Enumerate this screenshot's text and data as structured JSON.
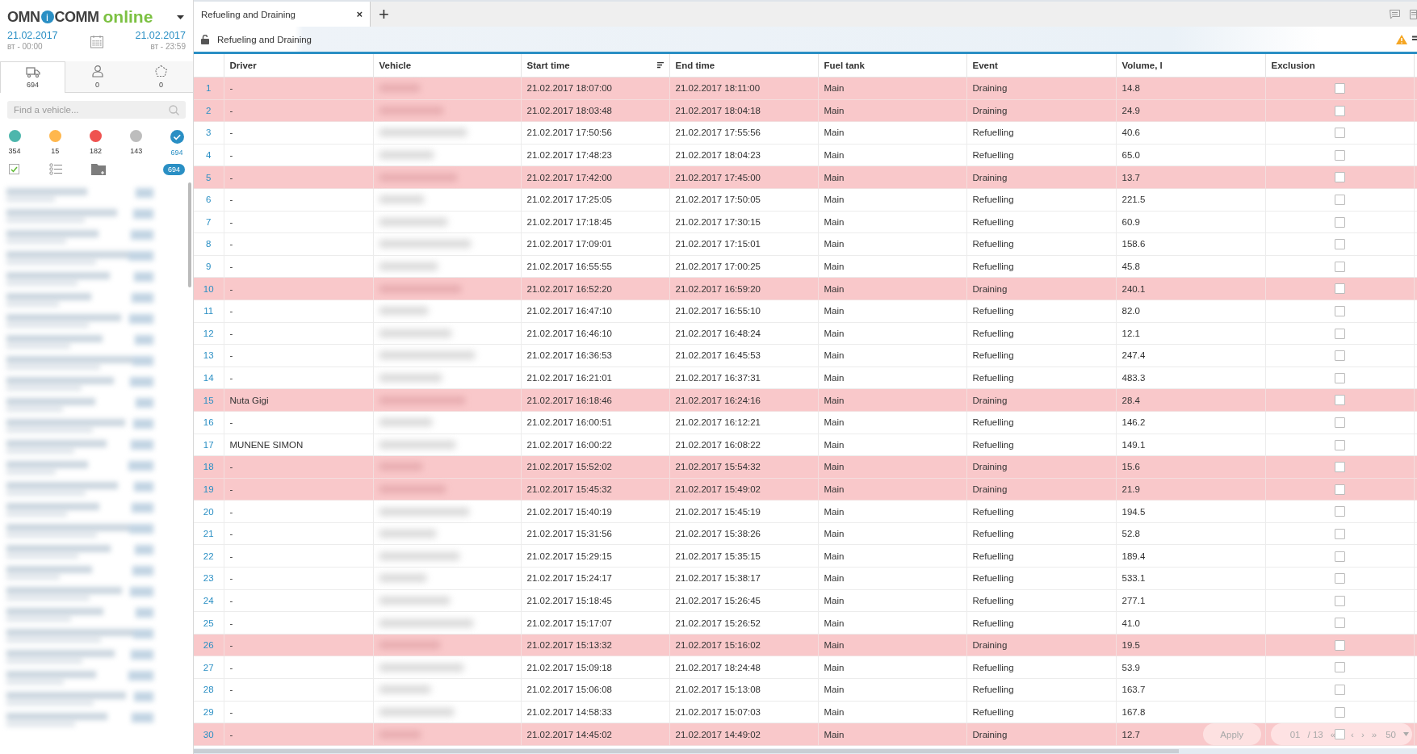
{
  "sidebar": {
    "logo": {
      "part_1": "OMN",
      "badge": "i",
      "part_2": "COMM",
      "suffix": "online"
    },
    "period": {
      "from_date": "21.02.2017",
      "from_time": "вт - 00:00",
      "to_date": "21.02.2017",
      "to_time": "вт - 23:59"
    },
    "tabs": [
      {
        "kind": "truck",
        "count": "694",
        "selected": true
      },
      {
        "kind": "person",
        "count": "0",
        "selected": false
      },
      {
        "kind": "geofence",
        "count": "0",
        "selected": false
      }
    ],
    "search": {
      "placeholder": "Find a vehicle..."
    },
    "status_filters": [
      {
        "kind": "dot",
        "color": "#4db6ac",
        "count": "354"
      },
      {
        "kind": "dot",
        "color": "#ffb74d",
        "count": "15"
      },
      {
        "kind": "dot",
        "color": "#ef5350",
        "count": "182"
      },
      {
        "kind": "dot",
        "color": "#bdbdbd",
        "count": "143"
      },
      {
        "kind": "check",
        "color": "#2a8fc4",
        "count": "694"
      }
    ],
    "toolbar": {
      "select_all_checked": true,
      "total_badge": "694"
    }
  },
  "tab_bar": {
    "tabs": [
      {
        "label": "Refueling and Draining",
        "close": "×",
        "selected": true
      }
    ],
    "add": "+"
  },
  "report": {
    "title": "Refueling and Draining",
    "locked": false
  },
  "table": {
    "columns": [
      "Driver",
      "Vehicle",
      "Start time",
      "End time",
      "Fuel tank",
      "Event",
      "Volume, l",
      "Exclusion"
    ],
    "rows": [
      {
        "n": "1",
        "driver": "-",
        "start": "21.02.2017 18:07:00",
        "end": "21.02.2017 18:11:00",
        "tank": "Main",
        "event": "Draining",
        "volume": "14.8",
        "highlighted": true,
        "checked": false
      },
      {
        "n": "2",
        "driver": "-",
        "start": "21.02.2017 18:03:48",
        "end": "21.02.2017 18:04:18",
        "tank": "Main",
        "event": "Draining",
        "volume": "24.9",
        "highlighted": true,
        "checked": false
      },
      {
        "n": "3",
        "driver": "-",
        "start": "21.02.2017 17:50:56",
        "end": "21.02.2017 17:55:56",
        "tank": "Main",
        "event": "Refuelling",
        "volume": "40.6",
        "highlighted": false,
        "checked": false
      },
      {
        "n": "4",
        "driver": "-",
        "start": "21.02.2017 17:48:23",
        "end": "21.02.2017 18:04:23",
        "tank": "Main",
        "event": "Refuelling",
        "volume": "65.0",
        "highlighted": false,
        "checked": false
      },
      {
        "n": "5",
        "driver": "-",
        "start": "21.02.2017 17:42:00",
        "end": "21.02.2017 17:45:00",
        "tank": "Main",
        "event": "Draining",
        "volume": "13.7",
        "highlighted": true,
        "checked": false
      },
      {
        "n": "6",
        "driver": "-",
        "start": "21.02.2017 17:25:05",
        "end": "21.02.2017 17:50:05",
        "tank": "Main",
        "event": "Refuelling",
        "volume": "221.5",
        "highlighted": false,
        "checked": false
      },
      {
        "n": "7",
        "driver": "-",
        "start": "21.02.2017 17:18:45",
        "end": "21.02.2017 17:30:15",
        "tank": "Main",
        "event": "Refuelling",
        "volume": "60.9",
        "highlighted": false,
        "checked": false
      },
      {
        "n": "8",
        "driver": "-",
        "start": "21.02.2017 17:09:01",
        "end": "21.02.2017 17:15:01",
        "tank": "Main",
        "event": "Refuelling",
        "volume": "158.6",
        "highlighted": false,
        "checked": false
      },
      {
        "n": "9",
        "driver": "-",
        "start": "21.02.2017 16:55:55",
        "end": "21.02.2017 17:00:25",
        "tank": "Main",
        "event": "Refuelling",
        "volume": "45.8",
        "highlighted": false,
        "checked": false
      },
      {
        "n": "10",
        "driver": "-",
        "start": "21.02.2017 16:52:20",
        "end": "21.02.2017 16:59:20",
        "tank": "Main",
        "event": "Draining",
        "volume": "240.1",
        "highlighted": true,
        "checked": false
      },
      {
        "n": "11",
        "driver": "-",
        "start": "21.02.2017 16:47:10",
        "end": "21.02.2017 16:55:10",
        "tank": "Main",
        "event": "Refuelling",
        "volume": "82.0",
        "highlighted": false,
        "checked": false
      },
      {
        "n": "12",
        "driver": "-",
        "start": "21.02.2017 16:46:10",
        "end": "21.02.2017 16:48:24",
        "tank": "Main",
        "event": "Refuelling",
        "volume": "12.1",
        "highlighted": false,
        "checked": false
      },
      {
        "n": "13",
        "driver": "-",
        "start": "21.02.2017 16:36:53",
        "end": "21.02.2017 16:45:53",
        "tank": "Main",
        "event": "Refuelling",
        "volume": "247.4",
        "highlighted": false,
        "checked": false
      },
      {
        "n": "14",
        "driver": "-",
        "start": "21.02.2017 16:21:01",
        "end": "21.02.2017 16:37:31",
        "tank": "Main",
        "event": "Refuelling",
        "volume": "483.3",
        "highlighted": false,
        "checked": false
      },
      {
        "n": "15",
        "driver": "Nuta Gigi",
        "start": "21.02.2017 16:18:46",
        "end": "21.02.2017 16:24:16",
        "tank": "Main",
        "event": "Draining",
        "volume": "28.4",
        "highlighted": true,
        "checked": false
      },
      {
        "n": "16",
        "driver": "-",
        "start": "21.02.2017 16:00:51",
        "end": "21.02.2017 16:12:21",
        "tank": "Main",
        "event": "Refuelling",
        "volume": "146.2",
        "highlighted": false,
        "checked": false
      },
      {
        "n": "17",
        "driver": "MUNENE SIMON",
        "start": "21.02.2017 16:00:22",
        "end": "21.02.2017 16:08:22",
        "tank": "Main",
        "event": "Refuelling",
        "volume": "149.1",
        "highlighted": false,
        "checked": false
      },
      {
        "n": "18",
        "driver": "-",
        "start": "21.02.2017 15:52:02",
        "end": "21.02.2017 15:54:32",
        "tank": "Main",
        "event": "Draining",
        "volume": "15.6",
        "highlighted": true,
        "checked": false
      },
      {
        "n": "19",
        "driver": "-",
        "start": "21.02.2017 15:45:32",
        "end": "21.02.2017 15:49:02",
        "tank": "Main",
        "event": "Draining",
        "volume": "21.9",
        "highlighted": true,
        "checked": false
      },
      {
        "n": "20",
        "driver": "-",
        "start": "21.02.2017 15:40:19",
        "end": "21.02.2017 15:45:19",
        "tank": "Main",
        "event": "Refuelling",
        "volume": "194.5",
        "highlighted": false,
        "checked": false
      },
      {
        "n": "21",
        "driver": "-",
        "start": "21.02.2017 15:31:56",
        "end": "21.02.2017 15:38:26",
        "tank": "Main",
        "event": "Refuelling",
        "volume": "52.8",
        "highlighted": false,
        "checked": false
      },
      {
        "n": "22",
        "driver": "-",
        "start": "21.02.2017 15:29:15",
        "end": "21.02.2017 15:35:15",
        "tank": "Main",
        "event": "Refuelling",
        "volume": "189.4",
        "highlighted": false,
        "checked": false
      },
      {
        "n": "23",
        "driver": "-",
        "start": "21.02.2017 15:24:17",
        "end": "21.02.2017 15:38:17",
        "tank": "Main",
        "event": "Refuelling",
        "volume": "533.1",
        "highlighted": false,
        "checked": false
      },
      {
        "n": "24",
        "driver": "-",
        "start": "21.02.2017 15:18:45",
        "end": "21.02.2017 15:26:45",
        "tank": "Main",
        "event": "Refuelling",
        "volume": "277.1",
        "highlighted": false,
        "checked": false
      },
      {
        "n": "25",
        "driver": "-",
        "start": "21.02.2017 15:17:07",
        "end": "21.02.2017 15:26:52",
        "tank": "Main",
        "event": "Refuelling",
        "volume": "41.0",
        "highlighted": false,
        "checked": false
      },
      {
        "n": "26",
        "driver": "-",
        "start": "21.02.2017 15:13:32",
        "end": "21.02.2017 15:16:02",
        "tank": "Main",
        "event": "Draining",
        "volume": "19.5",
        "highlighted": true,
        "checked": false
      },
      {
        "n": "27",
        "driver": "-",
        "start": "21.02.2017 15:09:18",
        "end": "21.02.2017 18:24:48",
        "tank": "Main",
        "event": "Refuelling",
        "volume": "53.9",
        "highlighted": false,
        "checked": false
      },
      {
        "n": "28",
        "driver": "-",
        "start": "21.02.2017 15:06:08",
        "end": "21.02.2017 15:13:08",
        "tank": "Main",
        "event": "Refuelling",
        "volume": "163.7",
        "highlighted": false,
        "checked": false
      },
      {
        "n": "29",
        "driver": "-",
        "start": "21.02.2017 14:58:33",
        "end": "21.02.2017 15:07:03",
        "tank": "Main",
        "event": "Refuelling",
        "volume": "167.8",
        "highlighted": false,
        "checked": false
      },
      {
        "n": "30",
        "driver": "-",
        "start": "21.02.2017 14:45:02",
        "end": "21.02.2017 14:49:02",
        "tank": "Main",
        "event": "Draining",
        "volume": "12.7",
        "highlighted": true,
        "checked": false
      }
    ]
  },
  "footer": {
    "apply": "Apply",
    "page": "01",
    "pages": "/ 13",
    "first": "«",
    "prev": "‹",
    "next": "›",
    "last": "»",
    "page_size": "50"
  }
}
